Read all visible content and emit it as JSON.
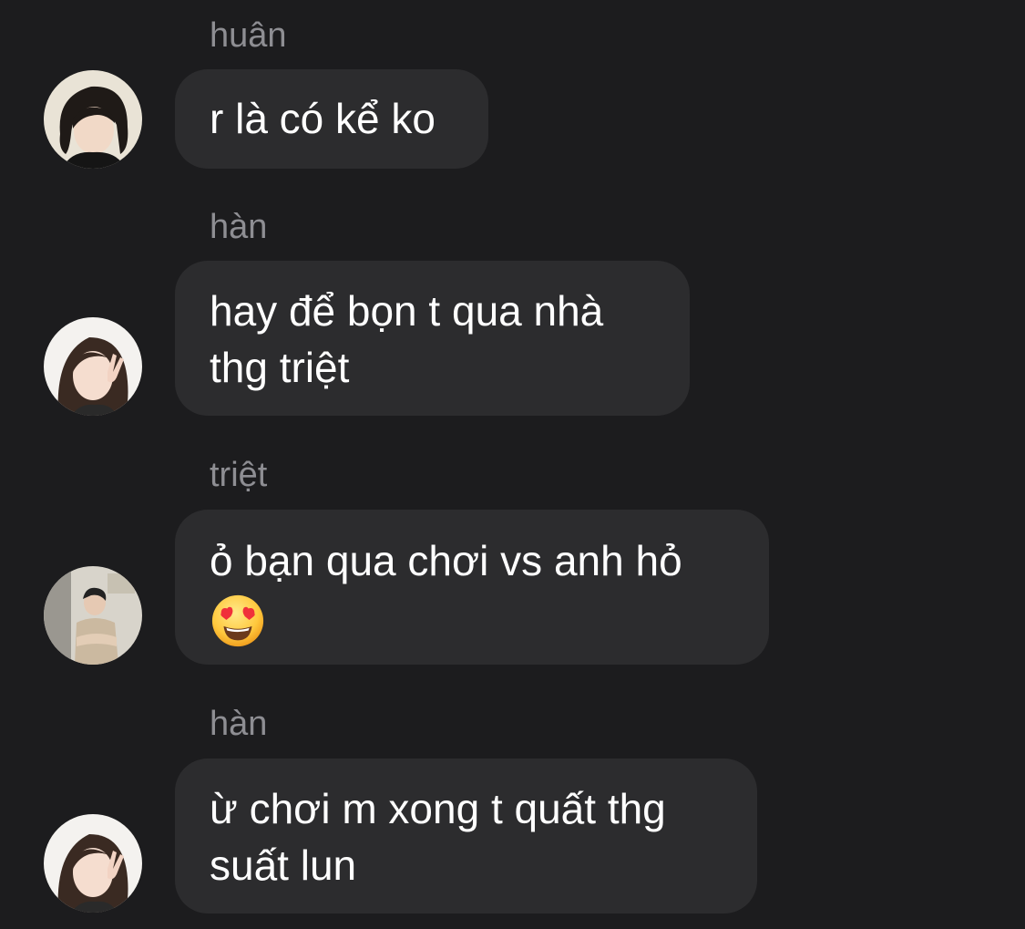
{
  "messages": [
    {
      "sender": "huân",
      "avatar": "avatar-dark-hair-boy",
      "lines": [
        "r là có kể ko"
      ]
    },
    {
      "sender": "hàn",
      "avatar": "avatar-girl-v-sign",
      "lines": [
        "hay để bọn t qua nhà",
        "thg triệt"
      ]
    },
    {
      "sender": "triệt",
      "avatar": "avatar-boy-arms-crossed",
      "lines": [
        "ỏ bạn qua chơi vs anh hỏ"
      ],
      "emoji": "heart-eyes-emoji"
    },
    {
      "sender": "hàn",
      "avatar": "avatar-girl-v-sign",
      "lines": [
        "ừ chơi m xong t quất thg",
        "suất lun"
      ]
    }
  ],
  "colors": {
    "background": "#1c1c1e",
    "bubble": "#2c2c2e",
    "sender_text": "#8e8e93",
    "message_text": "#ffffff"
  }
}
